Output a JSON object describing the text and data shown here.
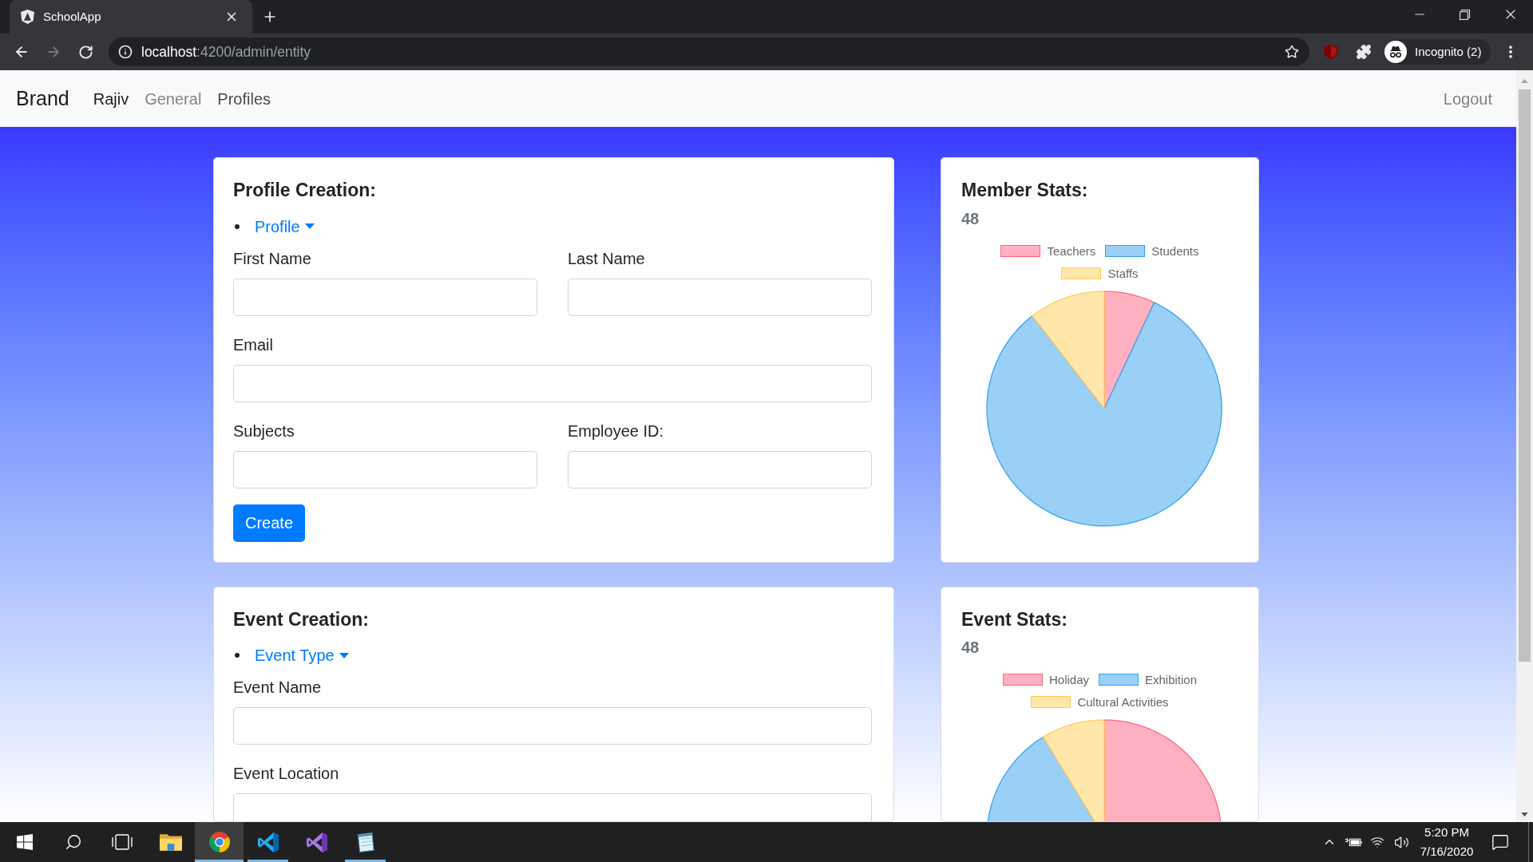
{
  "browser": {
    "tabs": [
      {
        "title": "SchoolApp",
        "selected": true
      }
    ],
    "forward_button": {
      "disabled": true
    },
    "address_bar": {
      "host": "localhost",
      "path": ":4200/admin/entity"
    },
    "profile_chip": "Incognito (2)"
  },
  "navbar": {
    "brand": "Brand",
    "items": [
      {
        "label": "Rajiv",
        "selected": true,
        "hovered": false
      },
      {
        "label": "General",
        "selected": false,
        "hovered": false
      },
      {
        "label": "Profiles",
        "selected": false,
        "hovered": true
      }
    ],
    "logout": "Logout"
  },
  "cards": [
    {
      "kind": "form",
      "title": "Profile Creation:",
      "dropdown": "Profile",
      "rows": [
        [
          {
            "label": "First Name"
          },
          {
            "label": "Last Name"
          }
        ],
        [
          {
            "label": "Email"
          }
        ],
        [
          {
            "label": "Subjects"
          },
          {
            "label": "Employee ID:"
          }
        ]
      ],
      "button": "Create"
    },
    {
      "kind": "stats",
      "title": "Member Stats:",
      "total": "48",
      "legend": [
        {
          "label": "Teachers",
          "color": "#ffb1c1"
        },
        {
          "label": "Students",
          "color": "#9ad0f5"
        },
        {
          "label": "Staffs",
          "color": "#ffe6aa"
        }
      ]
    },
    {
      "kind": "form",
      "title": "Event Creation:",
      "dropdown": "Event Type",
      "rows": [
        [
          {
            "label": "Event Name"
          }
        ],
        [
          {
            "label": "Event Location"
          }
        ]
      ]
    },
    {
      "kind": "stats",
      "title": "Event Stats:",
      "total": "48",
      "legend": [
        {
          "label": "Holiday",
          "color": "#ffb1c1"
        },
        {
          "label": "Exhibition",
          "color": "#9ad0f5"
        },
        {
          "label": "Cultural Activities",
          "color": "#ffe6aa"
        }
      ]
    }
  ],
  "taskbar": {
    "apps": [
      {
        "kind": "explorer",
        "running": false,
        "selected": false
      },
      {
        "kind": "chrome",
        "running": true,
        "selected": true
      },
      {
        "kind": "vscode",
        "running": true,
        "selected": false
      },
      {
        "kind": "visualstudio",
        "running": false,
        "selected": false
      },
      {
        "kind": "notepad",
        "running": true,
        "selected": false
      }
    ],
    "clock": {
      "time": "5:20 PM",
      "date": "7/16/2020"
    }
  }
}
